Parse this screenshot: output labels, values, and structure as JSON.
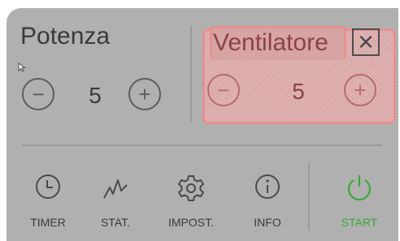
{
  "potenza": {
    "label": "Potenza",
    "value": "5",
    "minus": "−",
    "plus": "+"
  },
  "ventilatore": {
    "label": "Ventilatore",
    "value": "5",
    "minus": "−",
    "plus": "+",
    "close": "✕"
  },
  "nav": {
    "timer": {
      "label": "TIMER",
      "icon": "clock-icon"
    },
    "stat": {
      "label": "STAT.",
      "icon": "chart-icon"
    },
    "impost": {
      "label": "IMPOST.",
      "icon": "gear-icon"
    },
    "info": {
      "label": "INFO",
      "icon": "info-icon"
    },
    "start": {
      "label": "START",
      "icon": "power-icon"
    }
  },
  "colors": {
    "background": "#b0b0b0",
    "highlight": "#d8a3a3",
    "start": "#3aa83a"
  }
}
